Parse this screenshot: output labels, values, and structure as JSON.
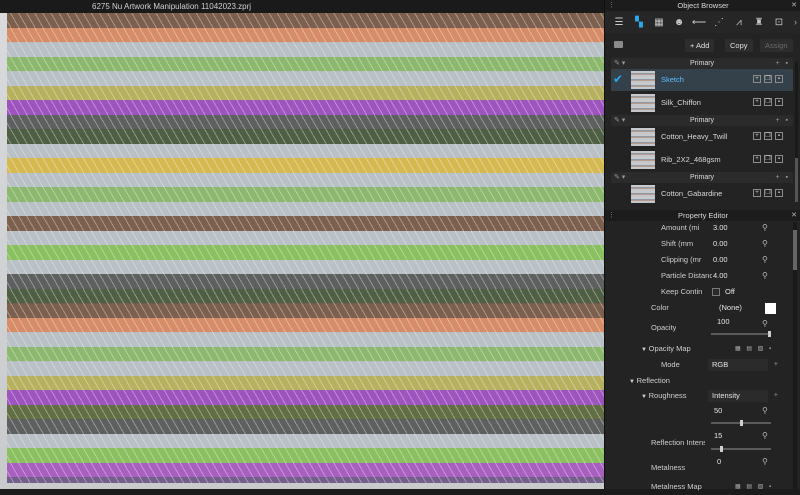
{
  "viewport": {
    "title": "6275 Nu Artwork Manipulation 11042023.zprj"
  },
  "colors": {
    "accent": "#2ea7e8",
    "knit_base": "#b9c0c6",
    "stripes": [
      "#7a5a48",
      "#d88a62",
      "#c9c9c9",
      "#8ab86a",
      "#b7b05a",
      "#9c4fbf",
      "#5a5a5a",
      "#4a5a3e",
      "#d8b84a",
      "#5e6a3e",
      "#88c05a",
      "#a85ac0",
      "#705a88"
    ]
  },
  "object_browser": {
    "header": "Object Browser",
    "toolbar_icons": [
      "list-icon",
      "shirt-icon",
      "texture-icon",
      "smiley-icon",
      "ruler-icon",
      "stitch-icon",
      "topstitch-icon",
      "avatar-icon",
      "button-icon"
    ],
    "add_label": "+ Add",
    "copy_label": "Copy",
    "assign_label": "Assign",
    "groups": [
      {
        "label": "Primary",
        "materials": [
          {
            "name": "Sketch",
            "selected": true
          },
          {
            "name": "Silk_Chiffon",
            "selected": false
          }
        ]
      },
      {
        "label": "Primary",
        "materials": [
          {
            "name": "Cotton_Heavy_Twill",
            "selected": false
          },
          {
            "name": "Rib_2X2_468gsm",
            "selected": false
          }
        ]
      },
      {
        "label": "Primary",
        "materials": [
          {
            "name": "Cotton_Gabardine",
            "selected": false
          }
        ]
      }
    ]
  },
  "property_editor": {
    "header": "Property Editor",
    "rows": {
      "amount": {
        "label": "Amount (mi",
        "value": "3.00"
      },
      "shift": {
        "label": "Shift (mm",
        "value": "0.00"
      },
      "clipping": {
        "label": "Clipping (mr",
        "value": "0.00"
      },
      "particle": {
        "label": "Particle Distanc",
        "value": "4.00"
      },
      "keep": {
        "label": "Keep Contin",
        "value": "Off"
      },
      "color": {
        "label": "Color",
        "value": "(None)"
      },
      "opacity": {
        "label": "Opacity",
        "value": "100",
        "level": 1.0
      },
      "opacity_map": {
        "label": "Opacity Map"
      },
      "mode": {
        "label": "Mode",
        "value": "RGB"
      },
      "reflection": {
        "label": "Reflection"
      },
      "roughness": {
        "label": "Roughness",
        "value": "Intensity"
      },
      "roughness_value": {
        "value": "50",
        "level": 0.5
      },
      "reflection_intensity": {
        "label": "Reflection Intens",
        "value": "15",
        "level": 0.15
      },
      "metalness": {
        "label": "Metalness",
        "value": "0"
      },
      "metalness_map": {
        "label": "Metalness Map"
      }
    }
  }
}
